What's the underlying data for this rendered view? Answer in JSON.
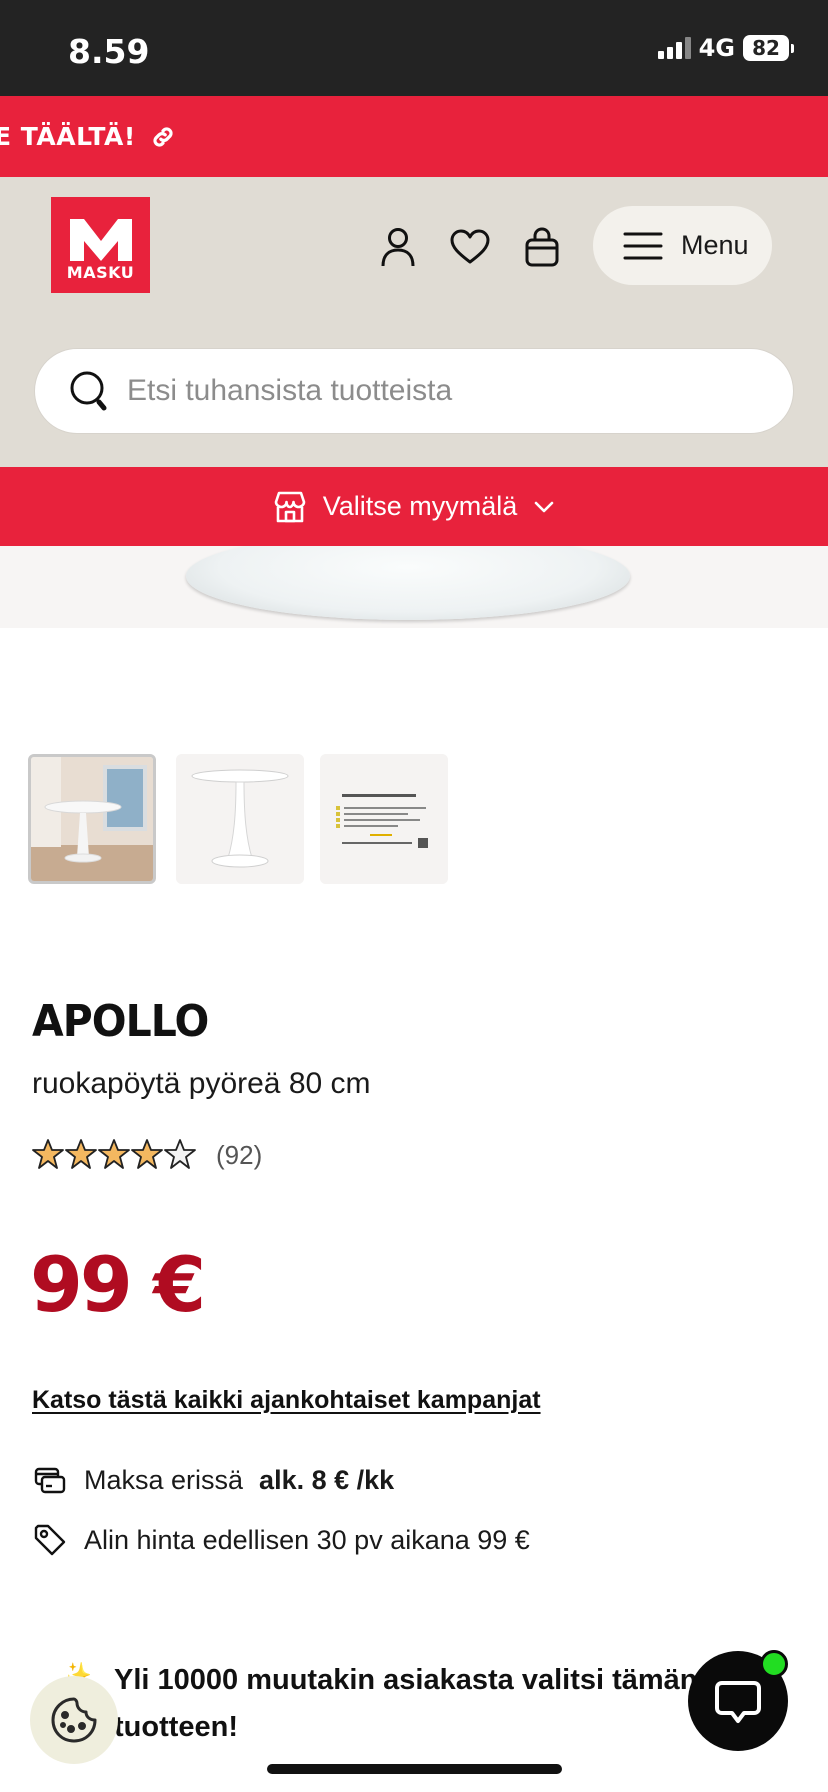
{
  "status_bar": {
    "time": "8.59",
    "network": "4G",
    "battery": "82"
  },
  "promo": {
    "text": "E TÄÄLTÄ!",
    "icon": "link-icon"
  },
  "header": {
    "logo_text": "MASKU",
    "icons": [
      "user-icon",
      "heart-icon",
      "bag-icon"
    ],
    "menu_label": "Menu"
  },
  "search": {
    "placeholder": "Etsi tuhansista tuotteista",
    "value": ""
  },
  "store": {
    "label": "Valitse myymälä"
  },
  "thumbnails": [
    {
      "name": "thumbnail-room-photo",
      "selected": true
    },
    {
      "name": "thumbnail-table-photo",
      "selected": false
    },
    {
      "name": "thumbnail-info-card",
      "selected": false
    }
  ],
  "product": {
    "brand": "APOLLO",
    "subtitle": "ruokapöytä pyöreä 80 cm",
    "rating": 4,
    "rating_max": 5,
    "review_count": "(92)",
    "price": "99 €",
    "campaign_link": "Katso tästä kaikki ajankohtaiset kampanjat",
    "installment_label": "Maksa erissä",
    "installment_value": "alk. 8 € /kk",
    "lowest_price": "Alin hinta edellisen 30 pv aikana 99 €"
  },
  "social_proof": {
    "text": "Yli 10000 muutakin asiakasta valitsi tämän tuotteen!"
  },
  "colors": {
    "brand_red": "#e8223c",
    "price_red": "#b00c21",
    "header_beige": "#e0dcd4",
    "online_green": "#22dd22"
  }
}
